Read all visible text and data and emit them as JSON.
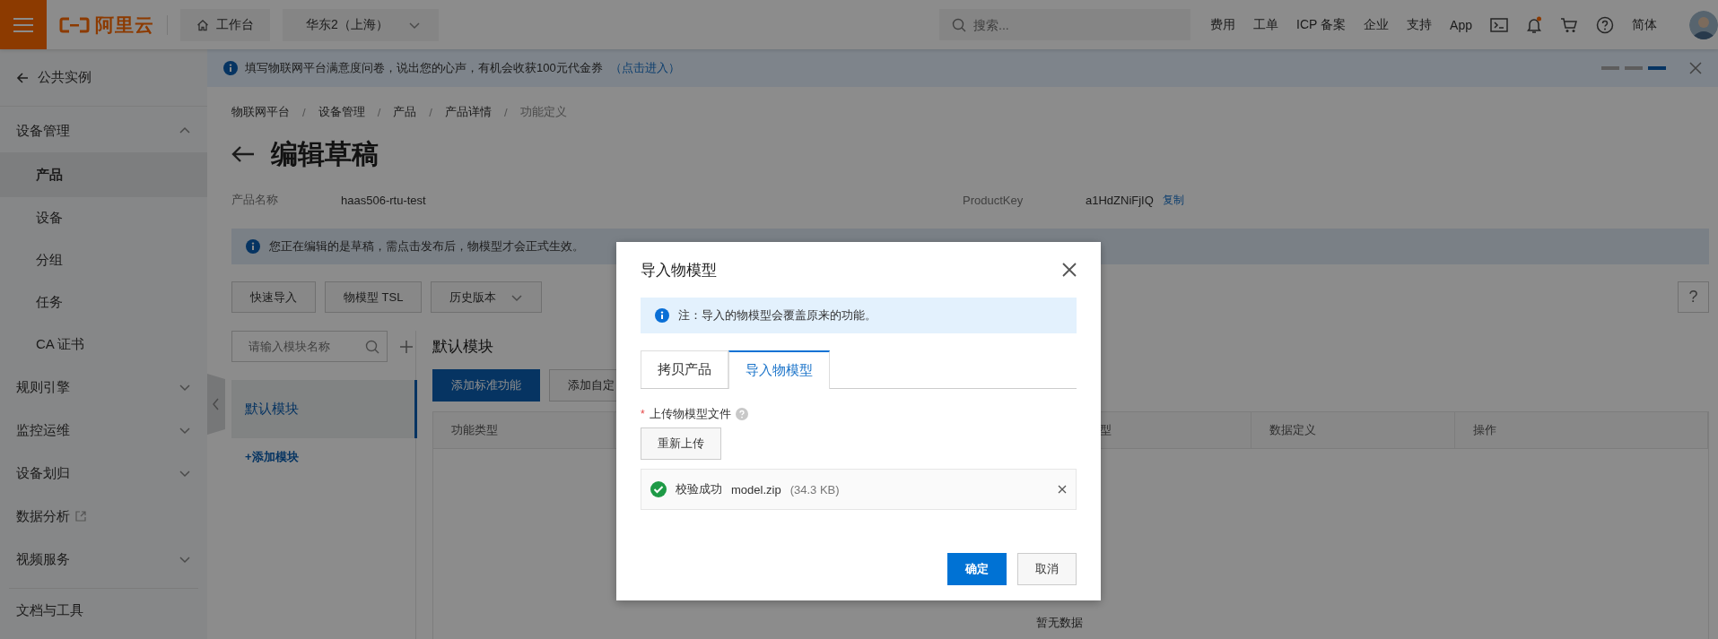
{
  "topbar": {
    "logo": "阿里云",
    "workbench": "工作台",
    "region": "华东2（上海）",
    "search": {
      "placeholder": "搜索..."
    },
    "links": [
      "费用",
      "工单",
      "ICP 备案",
      "企业",
      "支持",
      "App"
    ],
    "language": "简体"
  },
  "banner": {
    "text": "填写物联网平台满意度问卷，说出您的心声，有机会收获100元代金券",
    "link": "（点击进入）",
    "pager": [
      {
        "selected": false
      },
      {
        "selected": false
      },
      {
        "selected": true
      }
    ]
  },
  "sidebar": {
    "back": "公共实例",
    "items": [
      {
        "label": "设备管理",
        "kind": "group",
        "expanded": true,
        "children": [
          {
            "label": "产品",
            "selected": true
          },
          {
            "label": "设备",
            "selected": false
          },
          {
            "label": "分组",
            "selected": false
          },
          {
            "label": "任务",
            "selected": false
          },
          {
            "label": "CA 证书",
            "selected": false
          }
        ]
      },
      {
        "label": "规则引擎",
        "kind": "group",
        "expanded": false
      },
      {
        "label": "监控运维",
        "kind": "group",
        "expanded": false
      },
      {
        "label": "设备划归",
        "kind": "group",
        "expanded": false
      },
      {
        "label": "数据分析",
        "kind": "external"
      },
      {
        "label": "视频服务",
        "kind": "group",
        "expanded": false
      }
    ],
    "footer": "文档与工具"
  },
  "breadcrumb": {
    "items": [
      "物联网平台",
      "设备管理",
      "产品",
      "产品详情",
      "功能定义"
    ],
    "separators": [
      "/",
      "/",
      "/",
      "/"
    ]
  },
  "title": "编辑草稿",
  "product": {
    "name_label": "产品名称",
    "name": "haas506-rtu-test",
    "key_label": "ProductKey",
    "key": "a1HdZNiFjIQ",
    "copy": "复制"
  },
  "notice": "您正在编辑的是草稿，需点击发布后，物模型才会正式生效。",
  "toolbar": [
    {
      "label": "快速导入",
      "kind": "button"
    },
    {
      "label": "物模型 TSL",
      "kind": "button"
    },
    {
      "label": "历史版本",
      "kind": "dropdown"
    }
  ],
  "help": "?",
  "modules": {
    "search": {
      "placeholder": "请输入模块名称"
    },
    "items": [
      {
        "label": "默认模块",
        "selected": true
      }
    ],
    "add": "+添加模块"
  },
  "module_panel": {
    "title": "默认模块",
    "actions": [
      {
        "label": "添加标准功能",
        "primary": true
      },
      {
        "label": "添加自定",
        "primary": false
      }
    ],
    "columns": [
      "功能类型",
      "型",
      "数据定义",
      "操作"
    ],
    "empty": "暂无数据"
  },
  "dialog": {
    "title": "导入物模型",
    "note": "注：导入的物模型会覆盖原来的功能。",
    "tabs": [
      {
        "label": "拷贝产品",
        "selected": false
      },
      {
        "label": "导入物模型",
        "selected": true
      }
    ],
    "field": {
      "required_mark": "*",
      "label": "上传物模型文件"
    },
    "reupload": "重新上传",
    "file": {
      "status": "校验成功",
      "name": "model.zip",
      "size": "(34.3 KB)"
    },
    "buttons": [
      {
        "label": "确定",
        "primary": true
      },
      {
        "label": "取消",
        "primary": false
      }
    ]
  }
}
